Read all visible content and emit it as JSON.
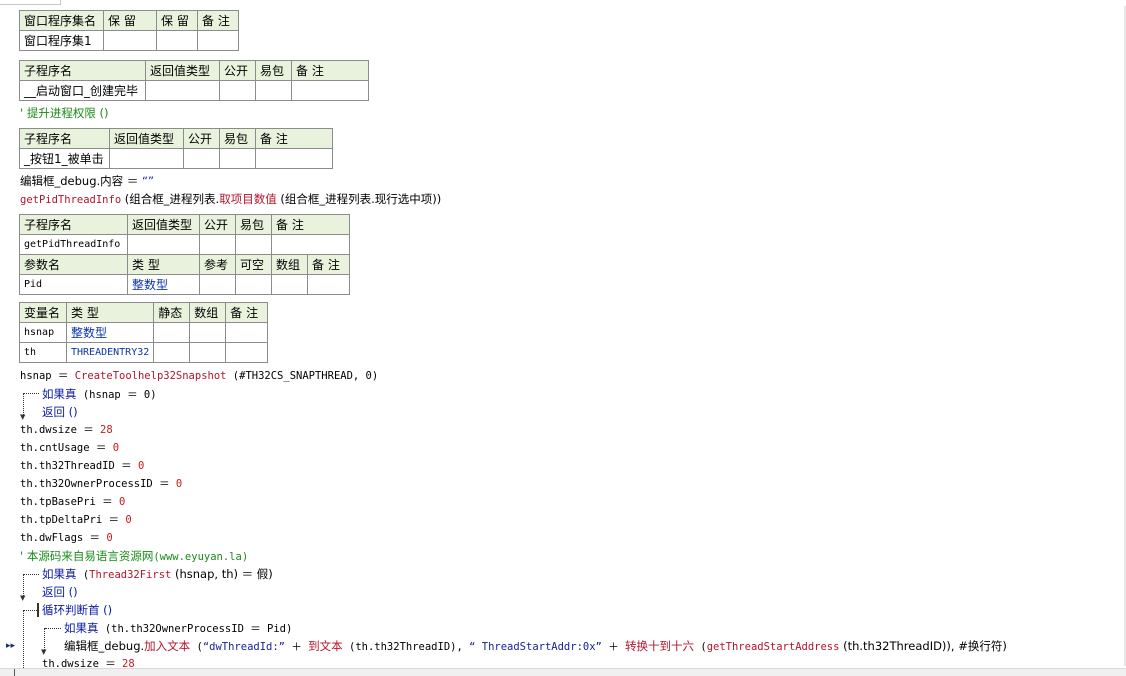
{
  "assembly_table": {
    "headers": [
      "窗口程序集名",
      "保 留",
      "保 留",
      "备 注"
    ],
    "row": [
      "窗口程序集1",
      "",
      "",
      ""
    ]
  },
  "sub1_table": {
    "headers": [
      "子程序名",
      "返回值类型",
      "公开",
      "易包",
      "备 注"
    ],
    "row": [
      "__启动窗口_创建完毕",
      "",
      "",
      "",
      ""
    ]
  },
  "sub2_table": {
    "headers": [
      "子程序名",
      "返回值类型",
      "公开",
      "易包",
      "备 注"
    ],
    "row": [
      "_按钮1_被单击",
      "",
      "",
      "",
      ""
    ]
  },
  "sub3_table": {
    "headers": [
      "子程序名",
      "返回值类型",
      "公开",
      "易包",
      "备 注"
    ],
    "row": [
      "getPidThreadInfo",
      "",
      "",
      "",
      ""
    ],
    "param_headers": [
      "参数名",
      "类 型",
      "参考",
      "可空",
      "数组",
      "备 注"
    ],
    "param_row": [
      "Pid",
      "整数型",
      "",
      "",
      "",
      ""
    ]
  },
  "var_table": {
    "headers": [
      "变量名",
      "类 型",
      "静态",
      "数组",
      "备 注"
    ],
    "rows": [
      [
        "hsnap",
        "整数型",
        "",
        "",
        ""
      ],
      [
        "th",
        "THREADENTRY32",
        "",
        "",
        ""
      ]
    ]
  },
  "code": {
    "l_priv_comment": "' 提升进程权限 ()",
    "l_edit_a": "编辑框_debug.内容 ＝ ",
    "l_edit_b": "“”",
    "l_get_a": "getPidThreadInfo",
    "l_get_b": " (组合框_进程列表.",
    "l_get_c": "取项目数值",
    "l_get_d": " (组合框_进程列表.现行选中项))",
    "l_hsnap_a": "hsnap ＝ ",
    "l_hsnap_b": "CreateToolhelp32Snapshot",
    "l_hsnap_c": " (#TH32CS_SNAPTHREAD, 0)",
    "l_if1_a": "如果真",
    "l_if1_b": " (hsnap ＝ 0)",
    "l_ret1": "返回 ()",
    "l_dw_a": "th.dwsize ＝ ",
    "l_dw_b": "28",
    "l_cnt_a": "th.cntUsage ＝ ",
    "l_cnt_b": "0",
    "l_tid_a": "th.th32ThreadID ＝ ",
    "l_tid_b": "0",
    "l_own_a": "th.th32OwnerProcessID ＝ ",
    "l_own_b": "0",
    "l_bp_a": "th.tpBasePri ＝ ",
    "l_bp_b": "0",
    "l_dp_a": "th.tpDeltaPri ＝ ",
    "l_dp_b": "0",
    "l_fl_a": "th.dwFlags ＝ ",
    "l_fl_b": "0",
    "l_src_a": "' 本源码来自易语言资源网",
    "l_src_b": "(www.eyuyan.la)",
    "l_if2_a": "如果真",
    "l_if2_b": " (",
    "l_if2_c": "Thread32First",
    "l_if2_d": " (hsnap, th) ＝ 假)",
    "l_ret2": "返回 ()",
    "l_loop": "循环判断首 ()",
    "l_if3_a": "如果真",
    "l_if3_b": " (th.th32OwnerProcessID ＝ Pid)",
    "l_add_a": "编辑框_debug.",
    "l_add_b": "加入文本",
    "l_add_c": " (",
    "l_add_d": "“dwThreadId:”",
    "l_add_e": " ＋ ",
    "l_add_f": "到文本",
    "l_add_g": " (th.th32ThreadID), ",
    "l_add_h": "“   ThreadStartAddr:0x”",
    "l_add_i": " ＋ ",
    "l_add_j": "转换十到十六",
    "l_add_k": " (",
    "l_add_l": "getThreadStartAddress",
    "l_add_m": " (th.th32ThreadID)), #换行符)",
    "l_dw2_a": "th.dwsize ＝ ",
    "l_dw2_b": "28"
  },
  "colors": {
    "header_bg": "#e9f2dc",
    "comment": "#1a8a1a",
    "keyword": "#0a1aa0",
    "function": "#b4142a",
    "number": "#c81a1a",
    "type": "#0b34a8"
  }
}
